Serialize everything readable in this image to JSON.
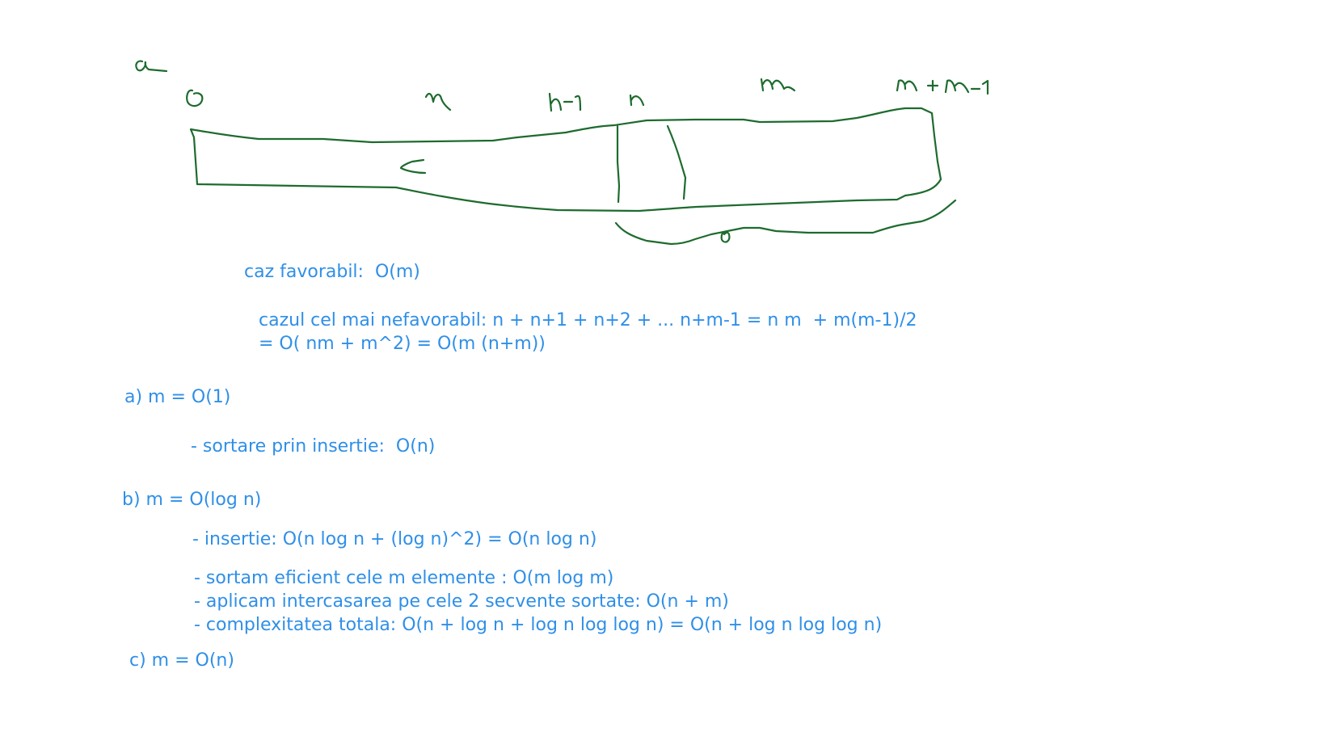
{
  "sketch": {
    "colors": {
      "ink": "#1e6b2e"
    },
    "labels": [
      "a",
      "0",
      "m",
      "n-1",
      "n",
      "m",
      "m + m-1",
      "<",
      "0"
    ]
  },
  "notes": {
    "color": "#2f8fe8",
    "caz_favorabil": "caz favorabil:  O(m)",
    "cazul_nefavorabil_1": "cazul cel mai nefavorabil: n + n+1 + n+2 + ... n+m-1 = n m  + m(m-1)/2",
    "cazul_nefavorabil_2": "= O( nm + m^2) = O(m (n+m))",
    "a_title": "a) m = O(1)",
    "a_item_1": "- sortare prin insertie:  O(n)",
    "b_title": "b) m = O(log n)",
    "b_item_1": "- insertie: O(n log n + (log n)^2) = O(n log n)",
    "b_item_2": "- sortam eficient cele m elemente : O(m log m)",
    "b_item_3": "- aplicam intercasarea pe cele 2 secvente sortate: O(n + m)",
    "b_item_4": "- complexitatea totala: O(n + log n + log n log log n) = O(n + log n log log n)",
    "c_title": "c) m = O(n)"
  }
}
